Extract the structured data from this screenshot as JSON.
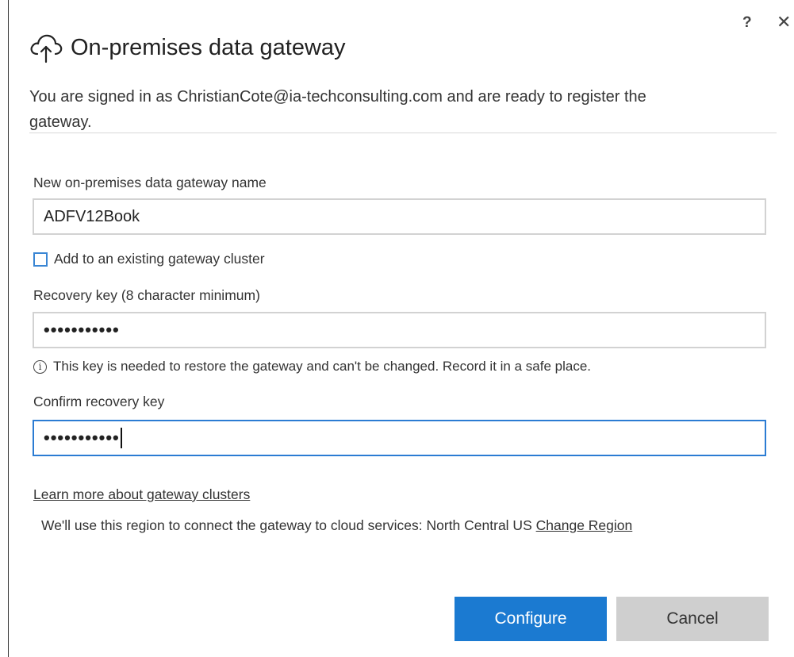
{
  "window": {
    "title": "On-premises data gateway",
    "help_label": "?",
    "close_label": "✕"
  },
  "subtitle": "You are signed in as ChristianCote@ia-techconsulting.com and are ready to register the gateway.",
  "form": {
    "name_label": "New on-premises data gateway name",
    "name_value": "ADFV12Book",
    "cluster_checkbox_label": "Add to an existing gateway cluster",
    "cluster_checked": false,
    "recovery_label": "Recovery key (8 character minimum)",
    "recovery_value": "•••••••••••",
    "info_icon_glyph": "i",
    "info_text": "This key is needed to restore the gateway and can't be changed. Record it in a safe place.",
    "confirm_label": "Confirm recovery key",
    "confirm_value": "•••••••••••"
  },
  "links": {
    "learn_more": "Learn more about gateway clusters",
    "region_text": "We'll use this region to connect the gateway to cloud services: North Central US",
    "change_region": "Change Region"
  },
  "buttons": {
    "configure": "Configure",
    "cancel": "Cancel"
  },
  "colors": {
    "accent": "#1b7ad1",
    "focus_border": "#2b7cd3",
    "secondary_button": "#cfcfcf"
  },
  "icons": {
    "title": "cloud-upload-icon",
    "info": "info-icon"
  }
}
